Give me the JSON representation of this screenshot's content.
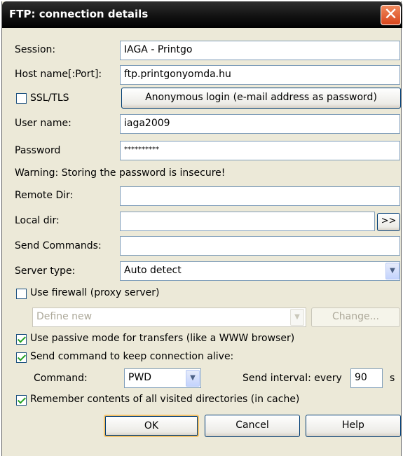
{
  "window": {
    "title": "FTP: connection details",
    "close_glyph": "✕"
  },
  "labels": {
    "session": "Session:",
    "host": "Host name[:Port]:",
    "ssl": "SSL/TLS",
    "user": "User name:",
    "password": "Password",
    "warning": "Warning: Storing the password is insecure!",
    "remote_dir": "Remote Dir:",
    "local_dir": "Local dir:",
    "send_commands": "Send Commands:",
    "server_type": "Server type:",
    "use_firewall": "Use firewall (proxy server)",
    "passive": "Use passive mode for transfers (like a WWW browser)",
    "keepalive": "Send command to keep connection alive:",
    "command": "Command:",
    "send_interval": "Send interval: every",
    "seconds": "s",
    "remember": "Remember contents of all visited directories (in cache)"
  },
  "values": {
    "session": "IAGA - Printgo",
    "host": "ftp.printgonyomda.hu",
    "user": "iaga2009",
    "password": "**********",
    "remote_dir": "",
    "local_dir": "",
    "send_commands": "",
    "server_type": "Auto detect",
    "firewall_option": "Define new",
    "command": "PWD",
    "interval": "90"
  },
  "checks": {
    "ssl": false,
    "firewall": false,
    "passive": true,
    "keepalive": true,
    "remember": true
  },
  "buttons": {
    "anonymous": "Anonymous login (e-mail address as password)",
    "browse": ">>",
    "change": "Change...",
    "ok": "OK",
    "cancel": "Cancel",
    "help": "Help"
  },
  "icons": {
    "dropdown": "chevron-down-icon",
    "close": "close-icon"
  }
}
